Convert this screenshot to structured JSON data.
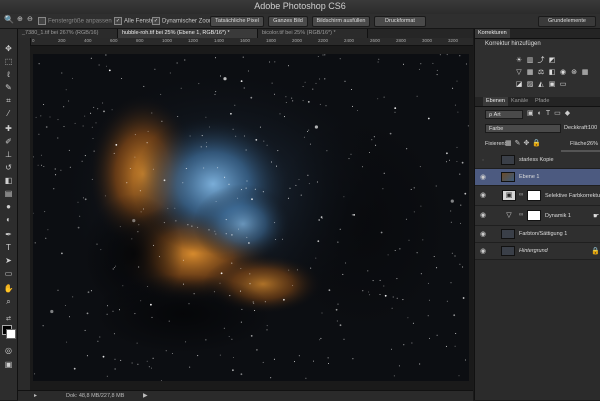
{
  "app": {
    "title": "Adobe Photoshop CS6"
  },
  "options_bar": {
    "resize_windows": "Fenstergröße anpassen",
    "all_windows": "Alle Fenster",
    "dynamic_zoom": "Dynamischer Zoom",
    "actual_pixels": "Tatsächliche Pixel",
    "fit_screen": "Ganzes Bild",
    "fill_screen": "Bildschirm ausfüllen",
    "print_size": "Druckformat",
    "workspace": "Grundelemente"
  },
  "tabs": [
    {
      "label": "_7380_1.tif bei 267% (RGB/16)"
    },
    {
      "label": "hubble-roh.tif bei 25% (Ebene 1, RGB/16*) *"
    },
    {
      "label": "bicolor.tif bei 25% (RGB/16*) *"
    }
  ],
  "ruler_ticks": [
    "0",
    "200",
    "400",
    "600",
    "800",
    "1000",
    "1200",
    "1400",
    "1600",
    "1800",
    "2000",
    "2200",
    "2400",
    "2600",
    "2800",
    "3000",
    "3200"
  ],
  "status": {
    "doc": "Dok: 48,8 MB/227,8 MB"
  },
  "panels": {
    "adjustments_tab": "Korrekturen",
    "add_adjustment": "Korrektur hinzufügen",
    "layers_tab": "Ebenen",
    "channels_tab": "Kanäle",
    "paths_tab": "Pfade",
    "kind_filter": "Art",
    "blend_mode": "Farbe",
    "opacity_label": "Deckkraft:",
    "opacity_value": "100",
    "lock_label": "Fixieren:",
    "fill_label": "Fläche:",
    "fill_value": "26%"
  },
  "layers": [
    {
      "name": "starless Kopie",
      "visible": false
    },
    {
      "name": "Ebene 1",
      "visible": true,
      "active": true
    },
    {
      "name": "Selektive Farbkorrektur 1",
      "visible": true
    },
    {
      "name": "Dynamik 1",
      "visible": true
    },
    {
      "name": "Farbton/Sättigung 1",
      "visible": true
    },
    {
      "name": "Hintergrund",
      "visible": true
    }
  ]
}
